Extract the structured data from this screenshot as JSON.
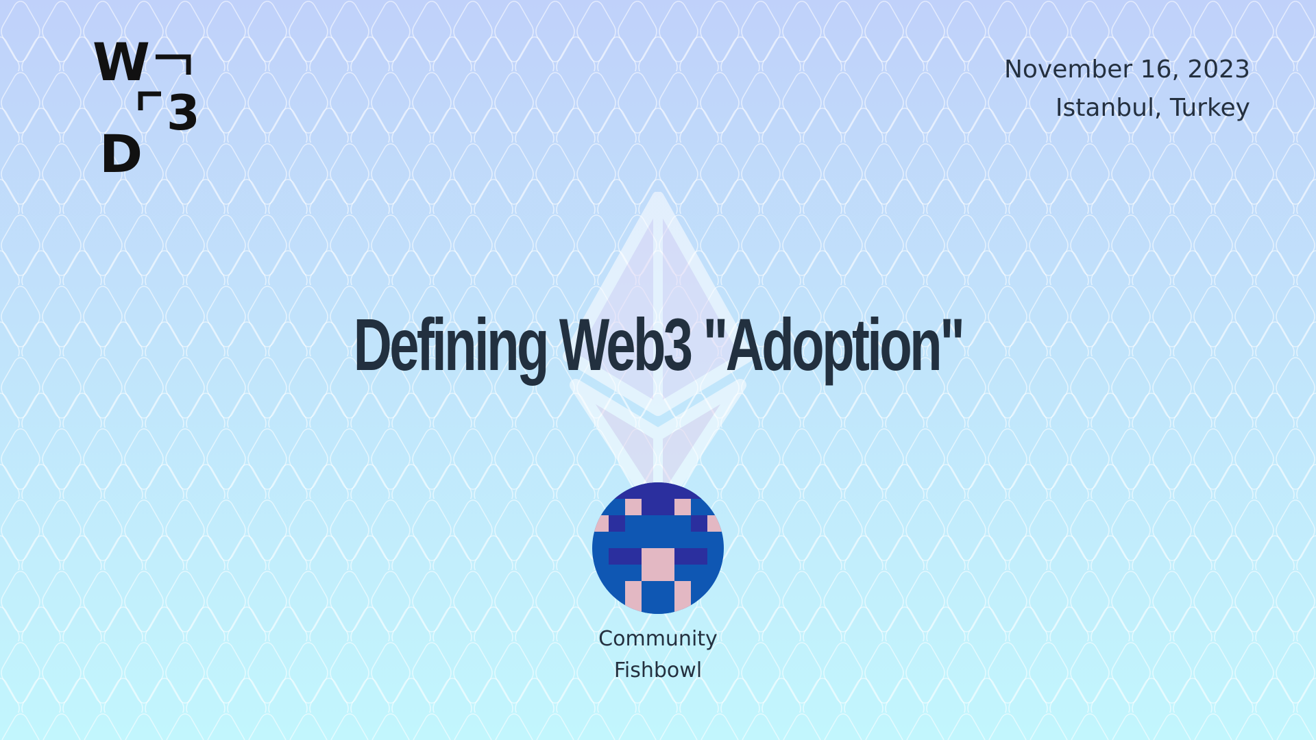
{
  "slide": {
    "logo": {
      "name": "W3D logo",
      "letters": [
        "W",
        "3",
        "D"
      ],
      "color": "#111111"
    },
    "event": {
      "date": "November 16, 2023",
      "location": "Istanbul, Turkey"
    },
    "title": "Defining Web3 \"Adoption\"",
    "speaker": {
      "line1": "Community",
      "line2": "Fishbowl",
      "avatar_icon": "pixel-art-avatar-icon"
    },
    "watermark_icon": "ethereum-icon",
    "colors": {
      "background_top": "#c0d1fa",
      "background_bottom": "#c2f6fd",
      "text": "#24303f",
      "avatar_dark_blue": "#2b2f9e",
      "avatar_blue": "#0f57b3",
      "avatar_pink": "#e3b8c3"
    }
  }
}
